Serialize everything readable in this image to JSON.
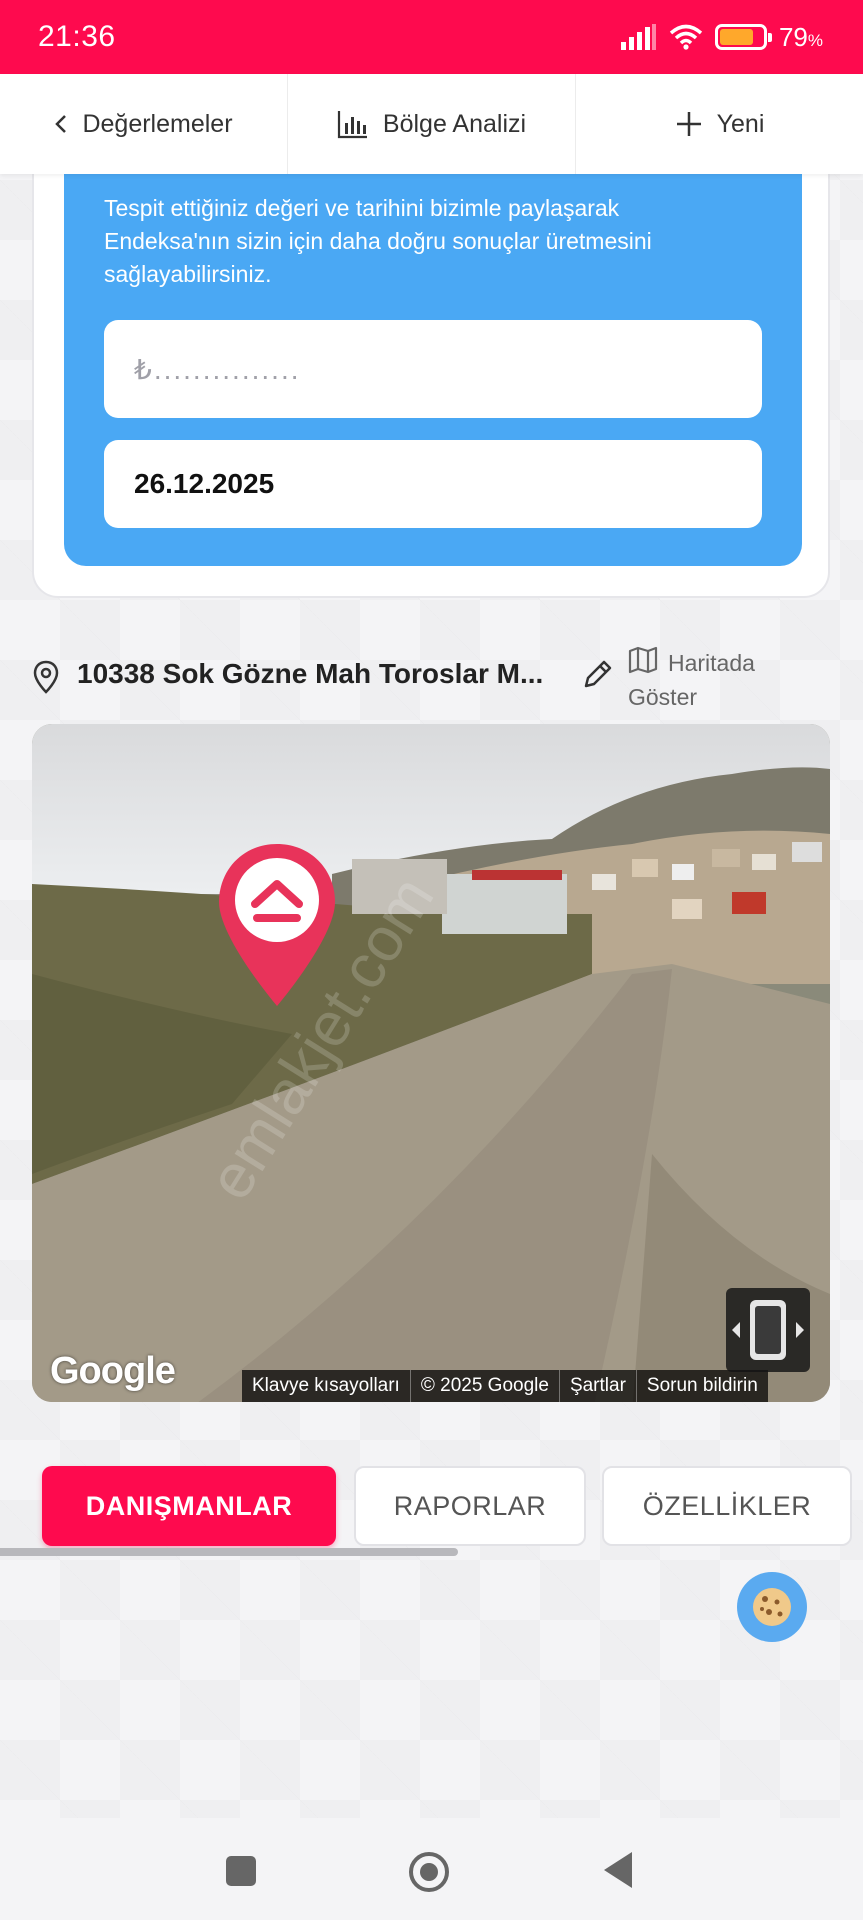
{
  "status_bar": {
    "time": "21:36",
    "battery_percent": "79",
    "battery_unit": "%",
    "battery_level": 0.79,
    "colors": {
      "background": "#fe0a4e",
      "battery_fill": "#ffa82b"
    }
  },
  "top_nav": {
    "back_label": "Değerlemeler",
    "analysis_label": "Bölge Analizi",
    "new_label": "Yeni"
  },
  "valuation_card": {
    "description": "Tespit ettiğiniz değeri ve tarihini bizimle paylaşarak Endeksa'nın sizin için daha doğru sonuçlar üretmesini sağlayabilirsiniz.",
    "price_placeholder": "₺...............",
    "date_value": "26.12.2025",
    "panel_color": "#4aa8f4"
  },
  "address": {
    "text": "10338 Sok Gözne Mah Toroslar M...",
    "map_link_line1": "Haritada",
    "map_link_line2": "Göster"
  },
  "streetview": {
    "logo": "Google",
    "footer": [
      "Klavye kısayolları",
      "© 2025 Google",
      "Şartlar",
      "Sorun bildirin"
    ],
    "watermark": "emlakjet.com"
  },
  "tabs": [
    {
      "label": "DANIŞMANLAR",
      "active": true
    },
    {
      "label": "RAPORLAR",
      "active": false
    },
    {
      "label": "ÖZELLİKLER",
      "active": false
    }
  ],
  "accent_color": "#fe0a4e"
}
